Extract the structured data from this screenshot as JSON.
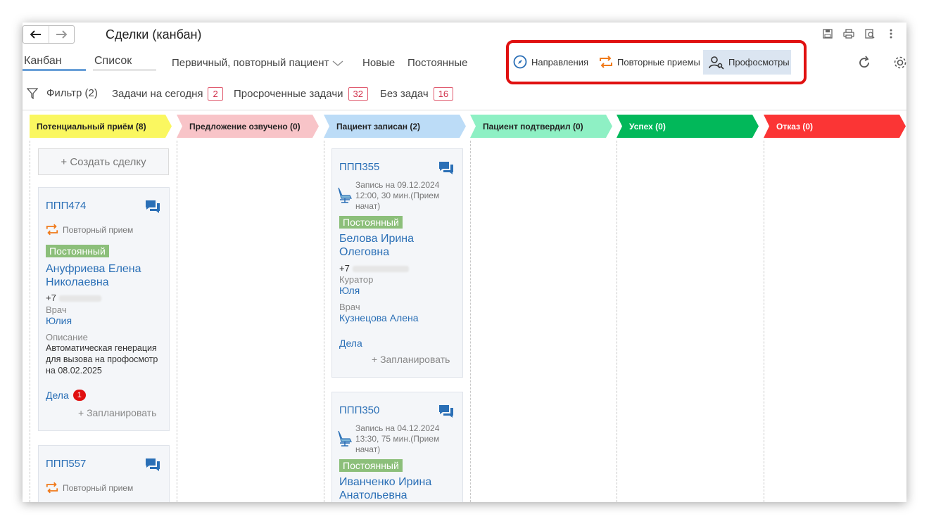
{
  "window": {
    "title": "Сделки (канбан)"
  },
  "view_tabs": [
    {
      "label": "Канбан"
    },
    {
      "label": "Список"
    }
  ],
  "filters": {
    "patient_type": "Первичный, повторный пациент",
    "new": "Новые",
    "regular": "Постоянные"
  },
  "quick_buttons": {
    "directions": "Направления",
    "repeat_visits": "Повторные приемы",
    "checkups": "Профосмотры"
  },
  "toolbar2": {
    "filter": "Фильтр (2)",
    "tasks_today": "Задачи на сегодня",
    "tasks_today_count": "2",
    "overdue": "Просроченные задачи",
    "overdue_count": "32",
    "no_tasks": "Без задач",
    "no_tasks_count": "16"
  },
  "stages": [
    {
      "label": "Потенциальный приём (8)",
      "color": "#faf760",
      "text_color": "#222"
    },
    {
      "label": "Предложение озвучено (0)",
      "color": "#f8c4c8",
      "text_color": "#222"
    },
    {
      "label": "Пациент записан (2)",
      "color": "#bcdcf7",
      "text_color": "#222"
    },
    {
      "label": "Пациент подтвердил (0)",
      "color": "#8ef0c4",
      "text_color": "#222"
    },
    {
      "label": "Успех (0)",
      "color": "#02b85a",
      "text_color": "#ffffff"
    },
    {
      "label": "Отказ (0)",
      "color": "#fb3535",
      "text_color": "#ffffff"
    }
  ],
  "create_deal": "+ Создать сделку",
  "cards": {
    "c474": {
      "id": "ППП474",
      "type": "Повторный прием",
      "tag": "Постоянный",
      "name": "Ануфриева Елена Николаевна",
      "phone_prefix": "+7",
      "doctor_label": "Врач",
      "doctor": "Юлия",
      "desc_label": "Описание",
      "desc": "Автоматическая генерация для вызова на профосмотр на 08.02.2025",
      "tasks": "Дела",
      "tasks_count": "1",
      "plan": "+ Запланировать"
    },
    "c557": {
      "id": "ППП557",
      "type": "Повторный прием"
    },
    "c355": {
      "id": "ППП355",
      "appt": "Запись на 09.12.2024 12:00, 30 мин.(Прием начат)",
      "tag": "Постоянный",
      "name": "Белова Ирина Олеговна",
      "phone_prefix": "+7",
      "curator_label": "Куратор",
      "curator": "Юля",
      "doctor_label": "Врач",
      "doctor": "Кузнецова Алена",
      "tasks": "Дела",
      "plan": "+ Запланировать"
    },
    "c350": {
      "id": "ППП350",
      "appt": "Запись на 04.12.2024 13:30, 75 мин.(Прием начат)",
      "tag": "Постоянный",
      "name": "Иванченко Ирина Анатольевна"
    }
  },
  "colors": {
    "accent": "#2a6fb6",
    "highlight_box": "#e01010",
    "badge_red": "#e01010",
    "repeat_orange": "#f07a1a"
  }
}
